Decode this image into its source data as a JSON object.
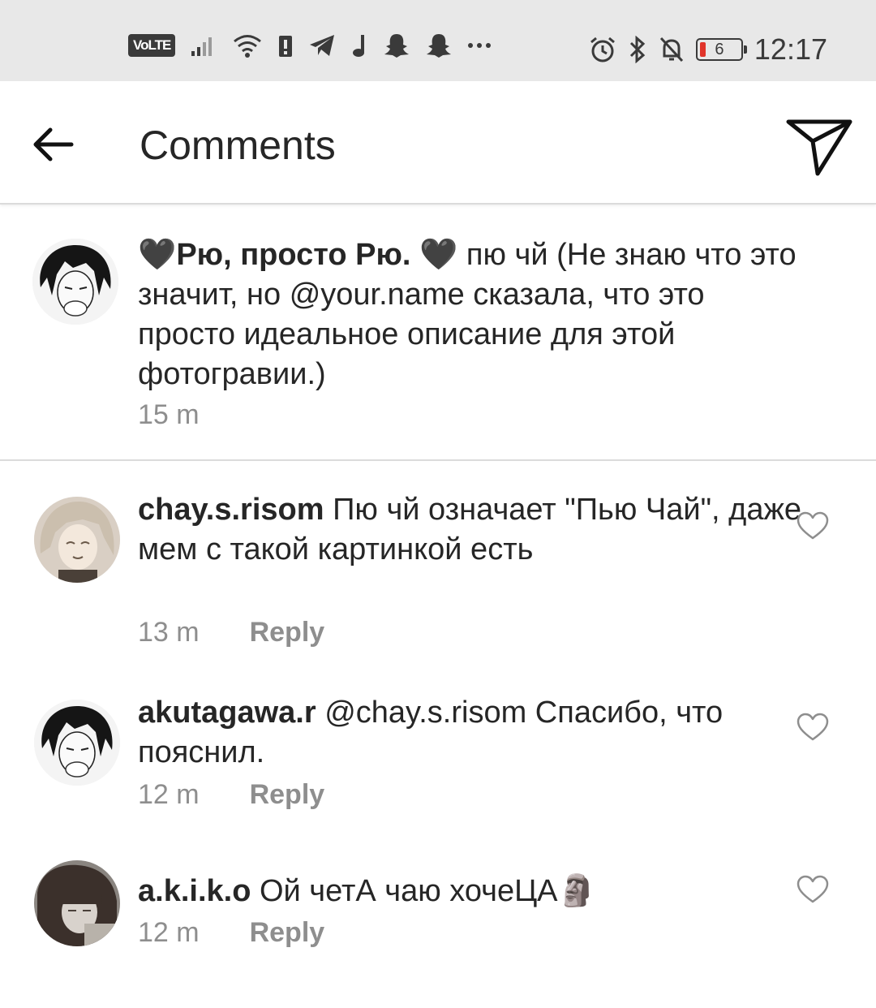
{
  "status_bar": {
    "volte": "VoLTE",
    "time": "12:17",
    "battery_level": "6",
    "icons_left": [
      "signal-icon",
      "wifi-icon",
      "sim-alert-icon",
      "telegram-icon",
      "music-icon",
      "snapchat-icon",
      "snapchat-icon",
      "more-icon"
    ],
    "icons_right": [
      "alarm-icon",
      "bluetooth-icon",
      "mute-icon",
      "battery-icon"
    ]
  },
  "header": {
    "title": "Comments",
    "back_icon": "arrow-left-icon",
    "send_icon": "paper-plane-icon"
  },
  "caption": {
    "username": "🖤Рю, просто Рю. 🖤",
    "text": " пю чй (Не знаю что это значит, но @your.name сказала, что это просто идеальное описание для этой фотогравии.)",
    "time": "15 m"
  },
  "comments": [
    {
      "username": "chay.s.risom",
      "text": " Пю чй означает \"Пью Чай\", даже мем с такой картинкой есть",
      "time": "13 m",
      "reply_label": "Reply"
    },
    {
      "username": "akutagawa.r",
      "text": " @chay.s.risom Спасибо, что пояснил.",
      "time": "12 m",
      "reply_label": "Reply"
    },
    {
      "username": "a.k.i.k.o",
      "text": " Ой четА чаю хочеЦА🗿",
      "time": "12 m",
      "reply_label": "Reply"
    }
  ],
  "colors": {
    "status_bar_bg": "#e8e8e8",
    "text": "#262626",
    "secondary_text": "#8e8e8e",
    "divider": "#dbdbdb",
    "battery_low": "#e0342a"
  }
}
